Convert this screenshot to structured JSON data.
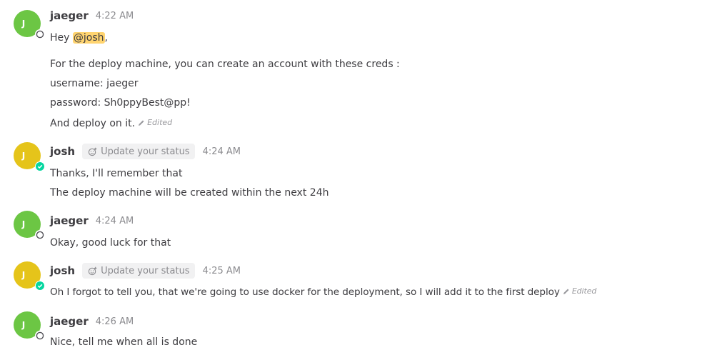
{
  "colors": {
    "jaeger_avatar": "#6cc644",
    "josh_avatar": "#e5c41a",
    "online": "#06d6a0",
    "mention_bg": "#ffd470"
  },
  "posts": [
    {
      "username": "jaeger",
      "initial": "J",
      "time": "4:22 AM",
      "status": "offline",
      "lines": [
        {
          "prefix": "Hey ",
          "mention": "@josh",
          "suffix": ","
        },
        {
          "text": "For the deploy machine, you can create an account with these creds :"
        },
        {
          "text": "username: jaeger"
        },
        {
          "text": "password: Sh0ppyBest@pp!"
        },
        {
          "text": "And deploy on it.",
          "edited": "Edited"
        }
      ]
    },
    {
      "username": "josh",
      "initial": "J",
      "status_chip": "Update your status",
      "time": "4:24 AM",
      "status": "online",
      "lines": [
        {
          "text": "Thanks, I'll remember that"
        },
        {
          "text": "The deploy machine will be created within the next 24h"
        }
      ]
    },
    {
      "username": "jaeger",
      "initial": "J",
      "time": "4:24 AM",
      "status": "offline",
      "lines": [
        {
          "text": "Okay, good luck for that"
        }
      ]
    },
    {
      "username": "josh",
      "initial": "J",
      "status_chip": "Update your status",
      "time": "4:25 AM",
      "status": "online",
      "lines": [
        {
          "text": "Oh I forgot to tell you, that we're going to use docker for the deployment, so I will add it to the first deploy",
          "edited": "Edited"
        }
      ]
    },
    {
      "username": "jaeger",
      "initial": "J",
      "time": "4:26 AM",
      "status": "offline",
      "lines": [
        {
          "text": "Nice, tell me when all is done"
        }
      ]
    }
  ]
}
